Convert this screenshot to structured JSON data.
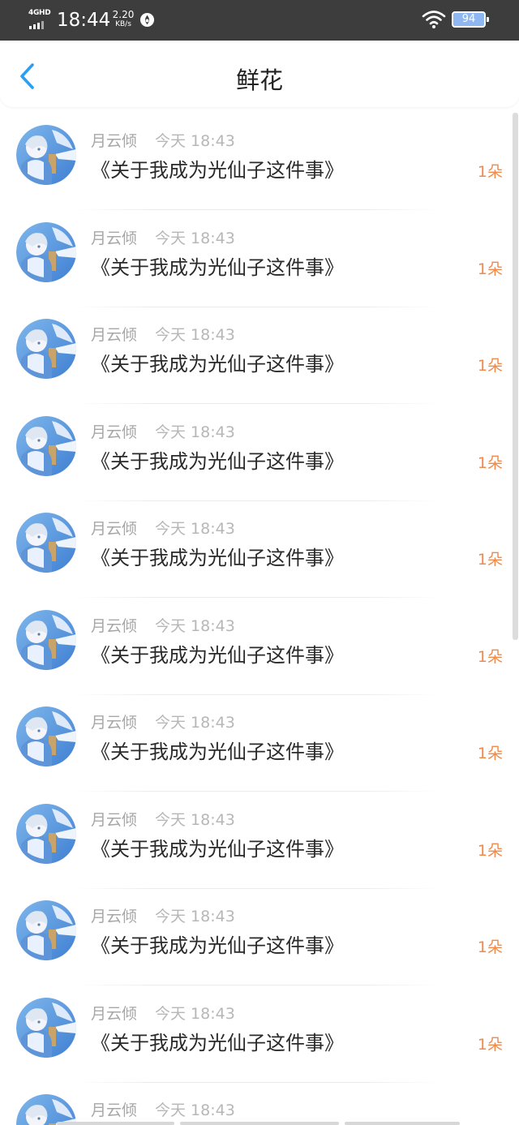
{
  "status_bar": {
    "network": "4GHD",
    "time": "18:44",
    "speed_value": "2.20",
    "speed_unit": "KB/s",
    "battery": "94",
    "icons": [
      "signal-icon",
      "app-notification-icon",
      "wifi-icon",
      "battery-icon"
    ]
  },
  "header": {
    "title": "鲜花",
    "back_icon": "chevron-left-icon",
    "accent_color": "#2b9ff3"
  },
  "colors": {
    "name": "#a7a7a7",
    "time": "#b7b7b7",
    "title": "#2a2a2a",
    "count": "#f08a4b"
  },
  "items": [
    {
      "author": "月云倾",
      "time": "今天 18:43",
      "book": "《关于我成为光仙子这件事》",
      "count": "1朵"
    },
    {
      "author": "月云倾",
      "time": "今天 18:43",
      "book": "《关于我成为光仙子这件事》",
      "count": "1朵"
    },
    {
      "author": "月云倾",
      "time": "今天 18:43",
      "book": "《关于我成为光仙子这件事》",
      "count": "1朵"
    },
    {
      "author": "月云倾",
      "time": "今天 18:43",
      "book": "《关于我成为光仙子这件事》",
      "count": "1朵"
    },
    {
      "author": "月云倾",
      "time": "今天 18:43",
      "book": "《关于我成为光仙子这件事》",
      "count": "1朵"
    },
    {
      "author": "月云倾",
      "time": "今天 18:43",
      "book": "《关于我成为光仙子这件事》",
      "count": "1朵"
    },
    {
      "author": "月云倾",
      "time": "今天 18:43",
      "book": "《关于我成为光仙子这件事》",
      "count": "1朵"
    },
    {
      "author": "月云倾",
      "time": "今天 18:43",
      "book": "《关于我成为光仙子这件事》",
      "count": "1朵"
    },
    {
      "author": "月云倾",
      "time": "今天 18:43",
      "book": "《关于我成为光仙子这件事》",
      "count": "1朵"
    },
    {
      "author": "月云倾",
      "time": "今天 18:43",
      "book": "《关于我成为光仙子这件事》",
      "count": "1朵"
    },
    {
      "author": "月云倾",
      "time": "今天 18:43",
      "book": "",
      "count": ""
    }
  ]
}
